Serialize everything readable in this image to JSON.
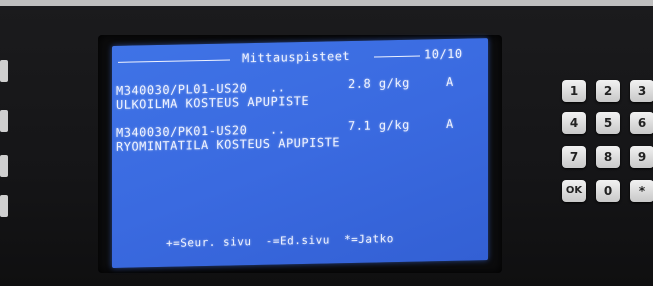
{
  "screen": {
    "header_title": "Mittauspisteet",
    "page_indicator": "10/10",
    "entries": [
      {
        "code": "M340030/PL01-US20",
        "dots": "..",
        "value": "2.8 g/kg",
        "flag": "A",
        "description": "ULKOILMA KOSTEUS APUPISTE"
      },
      {
        "code": "M340030/PK01-US20",
        "dots": "..",
        "value": "7.1 g/kg",
        "flag": "A",
        "description": "RYOMINTATILA KOSTEUS APUPISTE"
      }
    ],
    "footer_hints": "+=Seur. sivu  -=Ed.sivu  *=Jatko"
  },
  "keypad": {
    "keys": [
      "1",
      "2",
      "3",
      "4",
      "5",
      "6",
      "7",
      "8",
      "9",
      "OK",
      "0",
      "*"
    ]
  },
  "colors": {
    "screen_blue": "#3a6ae0",
    "screen_text": "#eef2ff",
    "panel": "#151517"
  }
}
